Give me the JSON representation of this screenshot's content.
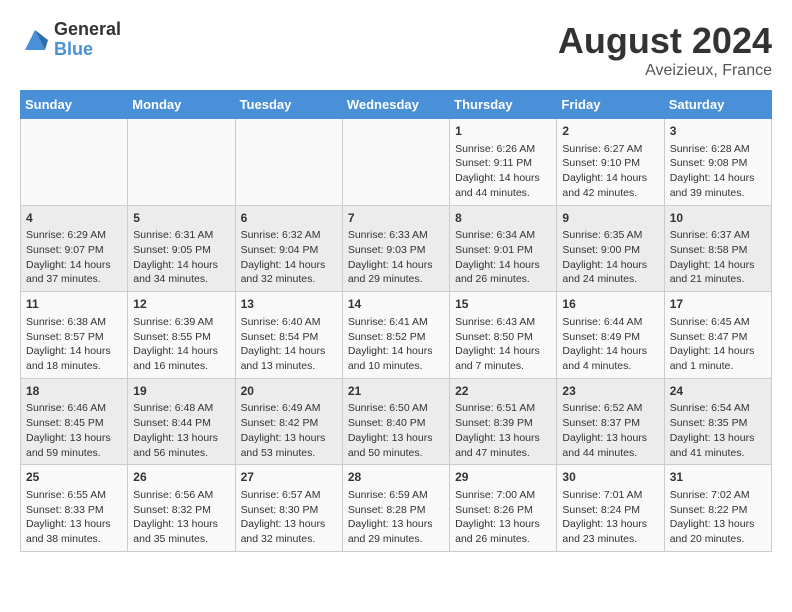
{
  "logo": {
    "general": "General",
    "blue": "Blue"
  },
  "title": "August 2024",
  "location": "Aveizieux, France",
  "days_of_week": [
    "Sunday",
    "Monday",
    "Tuesday",
    "Wednesday",
    "Thursday",
    "Friday",
    "Saturday"
  ],
  "weeks": [
    [
      {
        "day": "",
        "info": ""
      },
      {
        "day": "",
        "info": ""
      },
      {
        "day": "",
        "info": ""
      },
      {
        "day": "",
        "info": ""
      },
      {
        "day": "1",
        "info": "Sunrise: 6:26 AM\nSunset: 9:11 PM\nDaylight: 14 hours and 44 minutes."
      },
      {
        "day": "2",
        "info": "Sunrise: 6:27 AM\nSunset: 9:10 PM\nDaylight: 14 hours and 42 minutes."
      },
      {
        "day": "3",
        "info": "Sunrise: 6:28 AM\nSunset: 9:08 PM\nDaylight: 14 hours and 39 minutes."
      }
    ],
    [
      {
        "day": "4",
        "info": "Sunrise: 6:29 AM\nSunset: 9:07 PM\nDaylight: 14 hours and 37 minutes."
      },
      {
        "day": "5",
        "info": "Sunrise: 6:31 AM\nSunset: 9:05 PM\nDaylight: 14 hours and 34 minutes."
      },
      {
        "day": "6",
        "info": "Sunrise: 6:32 AM\nSunset: 9:04 PM\nDaylight: 14 hours and 32 minutes."
      },
      {
        "day": "7",
        "info": "Sunrise: 6:33 AM\nSunset: 9:03 PM\nDaylight: 14 hours and 29 minutes."
      },
      {
        "day": "8",
        "info": "Sunrise: 6:34 AM\nSunset: 9:01 PM\nDaylight: 14 hours and 26 minutes."
      },
      {
        "day": "9",
        "info": "Sunrise: 6:35 AM\nSunset: 9:00 PM\nDaylight: 14 hours and 24 minutes."
      },
      {
        "day": "10",
        "info": "Sunrise: 6:37 AM\nSunset: 8:58 PM\nDaylight: 14 hours and 21 minutes."
      }
    ],
    [
      {
        "day": "11",
        "info": "Sunrise: 6:38 AM\nSunset: 8:57 PM\nDaylight: 14 hours and 18 minutes."
      },
      {
        "day": "12",
        "info": "Sunrise: 6:39 AM\nSunset: 8:55 PM\nDaylight: 14 hours and 16 minutes."
      },
      {
        "day": "13",
        "info": "Sunrise: 6:40 AM\nSunset: 8:54 PM\nDaylight: 14 hours and 13 minutes."
      },
      {
        "day": "14",
        "info": "Sunrise: 6:41 AM\nSunset: 8:52 PM\nDaylight: 14 hours and 10 minutes."
      },
      {
        "day": "15",
        "info": "Sunrise: 6:43 AM\nSunset: 8:50 PM\nDaylight: 14 hours and 7 minutes."
      },
      {
        "day": "16",
        "info": "Sunrise: 6:44 AM\nSunset: 8:49 PM\nDaylight: 14 hours and 4 minutes."
      },
      {
        "day": "17",
        "info": "Sunrise: 6:45 AM\nSunset: 8:47 PM\nDaylight: 14 hours and 1 minute."
      }
    ],
    [
      {
        "day": "18",
        "info": "Sunrise: 6:46 AM\nSunset: 8:45 PM\nDaylight: 13 hours and 59 minutes."
      },
      {
        "day": "19",
        "info": "Sunrise: 6:48 AM\nSunset: 8:44 PM\nDaylight: 13 hours and 56 minutes."
      },
      {
        "day": "20",
        "info": "Sunrise: 6:49 AM\nSunset: 8:42 PM\nDaylight: 13 hours and 53 minutes."
      },
      {
        "day": "21",
        "info": "Sunrise: 6:50 AM\nSunset: 8:40 PM\nDaylight: 13 hours and 50 minutes."
      },
      {
        "day": "22",
        "info": "Sunrise: 6:51 AM\nSunset: 8:39 PM\nDaylight: 13 hours and 47 minutes."
      },
      {
        "day": "23",
        "info": "Sunrise: 6:52 AM\nSunset: 8:37 PM\nDaylight: 13 hours and 44 minutes."
      },
      {
        "day": "24",
        "info": "Sunrise: 6:54 AM\nSunset: 8:35 PM\nDaylight: 13 hours and 41 minutes."
      }
    ],
    [
      {
        "day": "25",
        "info": "Sunrise: 6:55 AM\nSunset: 8:33 PM\nDaylight: 13 hours and 38 minutes."
      },
      {
        "day": "26",
        "info": "Sunrise: 6:56 AM\nSunset: 8:32 PM\nDaylight: 13 hours and 35 minutes."
      },
      {
        "day": "27",
        "info": "Sunrise: 6:57 AM\nSunset: 8:30 PM\nDaylight: 13 hours and 32 minutes."
      },
      {
        "day": "28",
        "info": "Sunrise: 6:59 AM\nSunset: 8:28 PM\nDaylight: 13 hours and 29 minutes."
      },
      {
        "day": "29",
        "info": "Sunrise: 7:00 AM\nSunset: 8:26 PM\nDaylight: 13 hours and 26 minutes."
      },
      {
        "day": "30",
        "info": "Sunrise: 7:01 AM\nSunset: 8:24 PM\nDaylight: 13 hours and 23 minutes."
      },
      {
        "day": "31",
        "info": "Sunrise: 7:02 AM\nSunset: 8:22 PM\nDaylight: 13 hours and 20 minutes."
      }
    ]
  ]
}
